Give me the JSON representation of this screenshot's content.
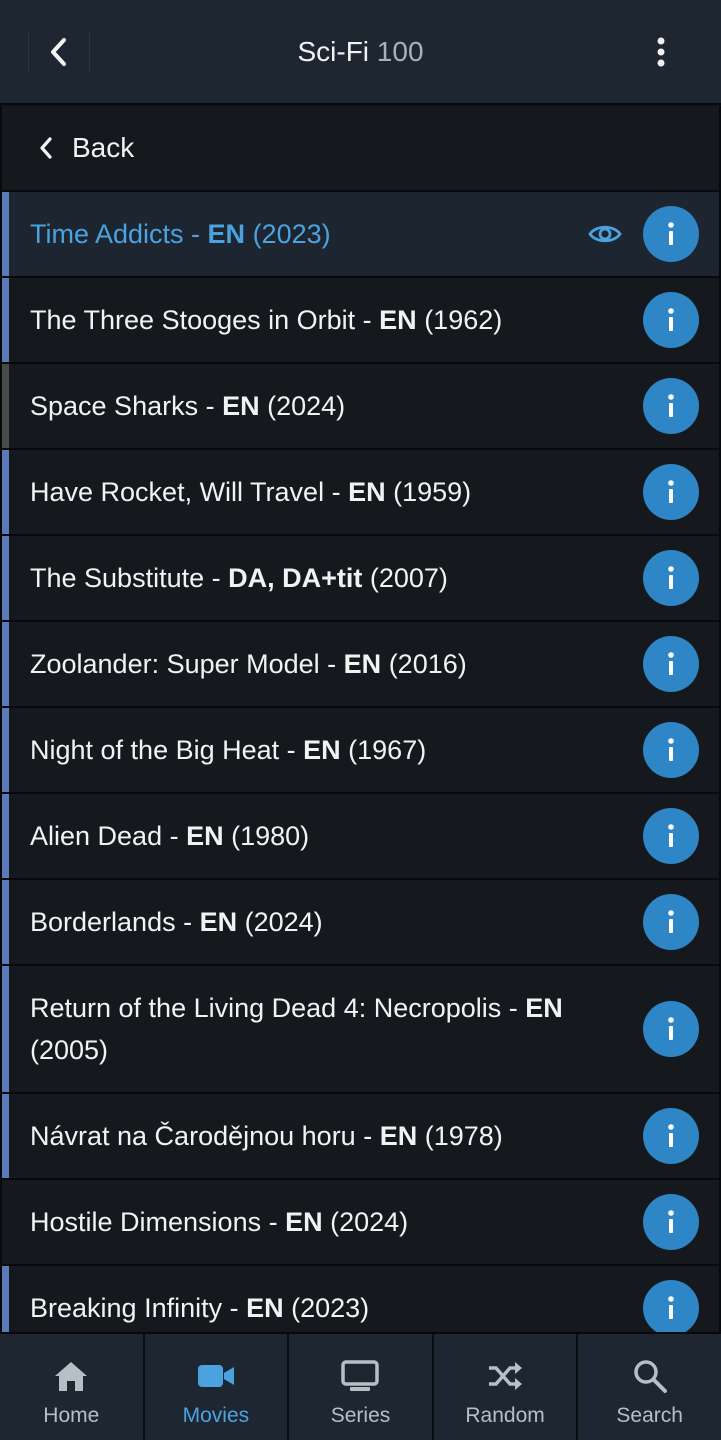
{
  "header": {
    "title": "Sci-Fi",
    "count": "100"
  },
  "back_row": {
    "label": "Back"
  },
  "items": [
    {
      "title": "Time Addicts - ",
      "lang": "EN",
      "year": " (2023)",
      "active": true,
      "watched": true,
      "marker": "blue"
    },
    {
      "title": "The Three Stooges in Orbit - ",
      "lang": "EN",
      "year": " (1962)",
      "marker": "blue"
    },
    {
      "title": "Space Sharks - ",
      "lang": "EN",
      "year": " (2024)",
      "marker": "grey"
    },
    {
      "title": "Have Rocket, Will Travel - ",
      "lang": "EN",
      "year": " (1959)",
      "marker": "blue"
    },
    {
      "title": "The Substitute - ",
      "lang": "DA, DA+tit",
      "year": " (2007)",
      "marker": "blue"
    },
    {
      "title": "Zoolander: Super Model - ",
      "lang": "EN",
      "year": " (2016)",
      "marker": "blue"
    },
    {
      "title": "Night of the Big Heat - ",
      "lang": "EN",
      "year": " (1967)",
      "marker": "blue"
    },
    {
      "title": "Alien Dead - ",
      "lang": "EN",
      "year": " (1980)",
      "marker": "blue"
    },
    {
      "title": "Borderlands - ",
      "lang": "EN",
      "year": " (2024)",
      "marker": "blue"
    },
    {
      "title": "Return of the Living Dead 4: Necropolis - ",
      "lang": "EN",
      "year": " (2005)",
      "marker": "blue",
      "tall": true
    },
    {
      "title": "Návrat na Čarodějnou horu - ",
      "lang": "EN",
      "year": " (1978)",
      "marker": "blue"
    },
    {
      "title": "Hostile Dimensions - ",
      "lang": "EN",
      "year": " (2024)",
      "marker": "none"
    },
    {
      "title": "Breaking Infinity - ",
      "lang": "EN",
      "year": " (2023)",
      "marker": "blue"
    }
  ],
  "tabs": [
    {
      "label": "Home",
      "icon": "home-icon"
    },
    {
      "label": "Movies",
      "icon": "video-camera-icon",
      "active": true
    },
    {
      "label": "Series",
      "icon": "tv-icon"
    },
    {
      "label": "Random",
      "icon": "shuffle-icon"
    },
    {
      "label": "Search",
      "icon": "search-icon"
    }
  ],
  "colors": {
    "accent": "#4aa3df",
    "info_button": "#2f86c6",
    "marker_blue": "#5b7bb8",
    "marker_grey": "#4a4a4a"
  }
}
